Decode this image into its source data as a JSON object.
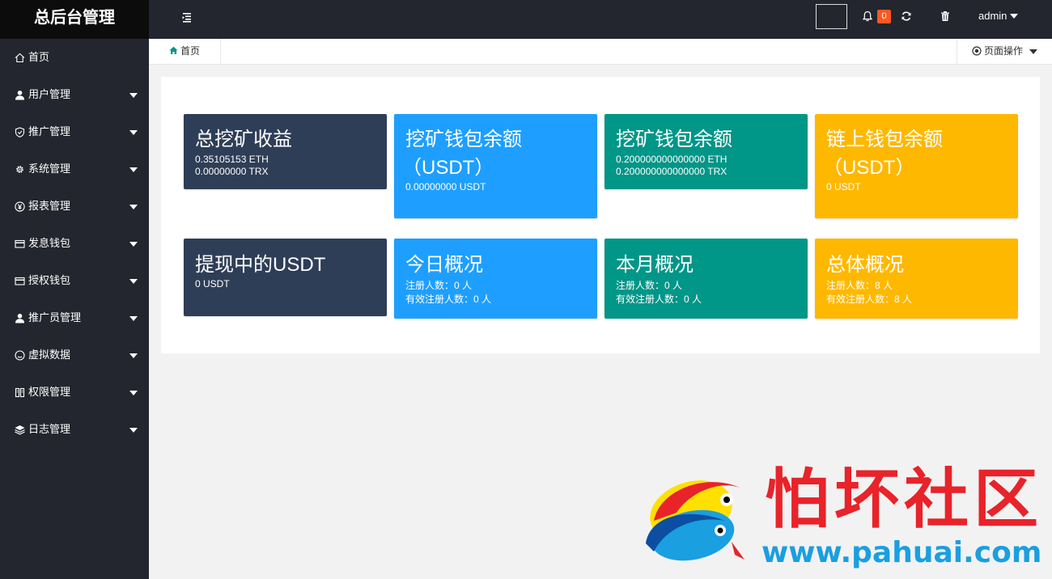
{
  "header": {
    "logo": "总后台管理",
    "notification_count": "0",
    "user": "admin"
  },
  "sidebar": {
    "items": [
      {
        "label": "首页",
        "icon": "home-icon",
        "has_arrow": false
      },
      {
        "label": "用户管理",
        "icon": "user-icon",
        "has_arrow": true
      },
      {
        "label": "推广管理",
        "icon": "shield-icon",
        "has_arrow": true
      },
      {
        "label": "系统管理",
        "icon": "gear-icon",
        "has_arrow": true
      },
      {
        "label": "报表管理",
        "icon": "yen-icon",
        "has_arrow": true
      },
      {
        "label": "发息钱包",
        "icon": "wallet-icon",
        "has_arrow": true
      },
      {
        "label": "授权钱包",
        "icon": "wallet-icon",
        "has_arrow": true
      },
      {
        "label": "推广员管理",
        "icon": "user-icon",
        "has_arrow": true
      },
      {
        "label": "虚拟数据",
        "icon": "smile-icon",
        "has_arrow": true
      },
      {
        "label": "权限管理",
        "icon": "permission-icon",
        "has_arrow": true
      },
      {
        "label": "日志管理",
        "icon": "layers-icon",
        "has_arrow": true
      }
    ]
  },
  "tabs": {
    "home_label": "首页",
    "page_ops_label": "页面操作"
  },
  "cards": [
    {
      "title": "总挖矿收益",
      "lines": [
        "0.35105153 ETH",
        "0.00000000 TRX"
      ],
      "color": "#2f3e57"
    },
    {
      "title": "挖矿钱包余额",
      "title2": "（USDT）",
      "lines": [
        "0.00000000 USDT"
      ],
      "color": "#1e9fff"
    },
    {
      "title": "挖矿钱包余额",
      "lines": [
        "0.200000000000000 ETH",
        "0.200000000000000 TRX"
      ],
      "color": "#009688"
    },
    {
      "title": "链上钱包余额",
      "title2": "（USDT）",
      "lines": [
        "0 USDT"
      ],
      "color": "#ffb800"
    },
    {
      "title": "提现中的USDT",
      "lines": [
        "0 USDT"
      ],
      "color": "#2f3e57"
    },
    {
      "title": "今日概况",
      "lines": [
        "注册人数：0 人",
        "有效注册人数：0 人"
      ],
      "color": "#1e9fff"
    },
    {
      "title": "本月概况",
      "lines": [
        "注册人数：0 人",
        "有效注册人数：0 人"
      ],
      "color": "#009688"
    },
    {
      "title": "总体概况",
      "lines": [
        "注册人数：8 人",
        "有效注册人数：8 人"
      ],
      "color": "#ffb800"
    }
  ],
  "watermark": {
    "text": "怕坏社区",
    "url": "www.pahuai.com"
  }
}
